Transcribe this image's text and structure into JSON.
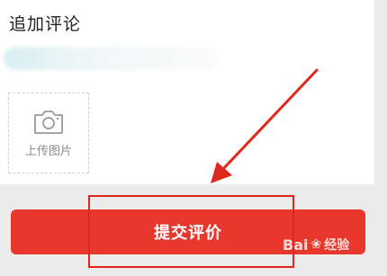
{
  "section": {
    "title": "追加评论"
  },
  "upload": {
    "label": "上传图片",
    "icon": "camera-icon"
  },
  "submit": {
    "label": "提交评价"
  },
  "watermark": {
    "brand_text_a": "Bai",
    "brand_text_b": "经验",
    "paw_icon": "paw-icon"
  },
  "colors": {
    "accent": "#e8382e",
    "annotation": "#e0271c",
    "background": "#ececec",
    "card": "#ffffff"
  }
}
